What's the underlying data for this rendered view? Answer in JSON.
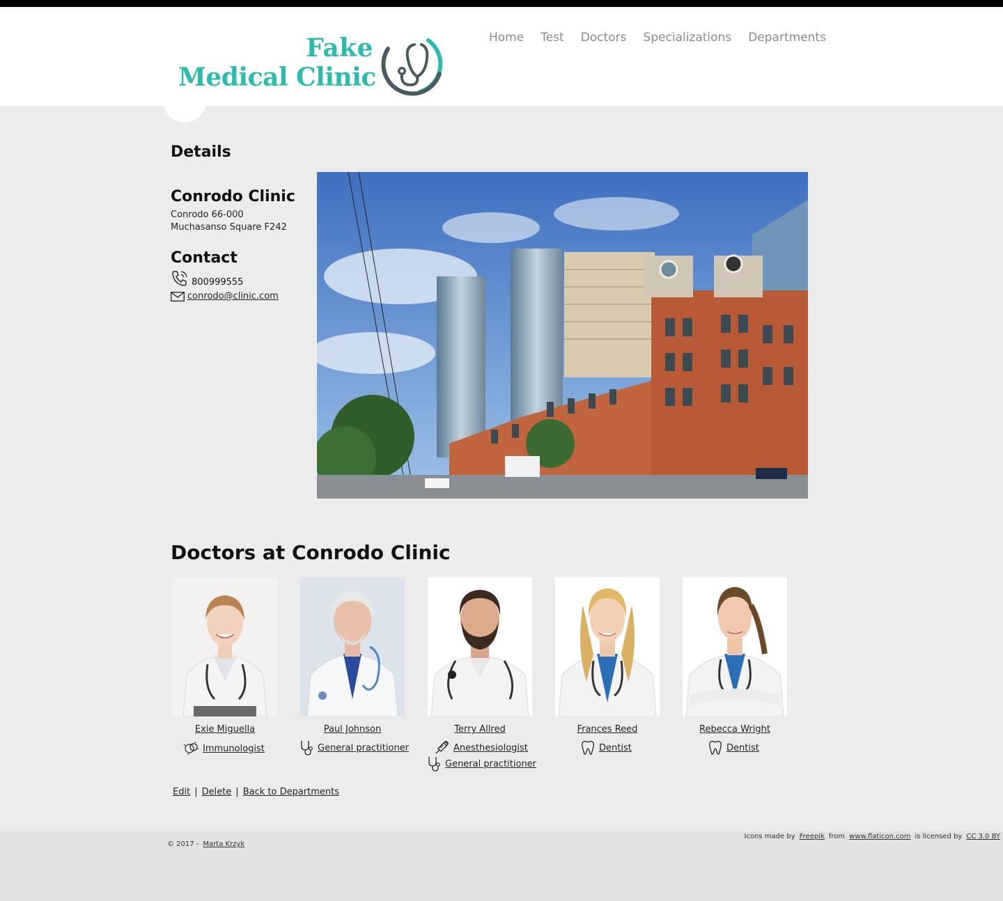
{
  "brand": {
    "line1": "Fake",
    "line2": "Medical Clinic",
    "color": "#2bbcad"
  },
  "nav": [
    {
      "label": "Home"
    },
    {
      "label": "Test"
    },
    {
      "label": "Doctors"
    },
    {
      "label": "Specializations"
    },
    {
      "label": "Departments"
    }
  ],
  "details": {
    "heading": "Details",
    "clinic_name": "Conrodo Clinic",
    "address_line1": "Conrodo 66-000",
    "address_line2": "Muchasanso Square F242",
    "contact_heading": "Contact",
    "phone": "800999555",
    "email": "conrodo@clinic.com"
  },
  "doctors_heading": "Doctors at Conrodo Clinic",
  "doctors": [
    {
      "name": "Exie Miguella",
      "specs": [
        {
          "label": "Immunologist",
          "icon": "immune-icon"
        }
      ]
    },
    {
      "name": "Paul Johnson",
      "specs": [
        {
          "label": "General practitioner",
          "icon": "stethoscope-icon"
        }
      ]
    },
    {
      "name": "Terry Allred",
      "specs": [
        {
          "label": "Anesthesiologist",
          "icon": "syringe-icon"
        },
        {
          "label": "General practitioner",
          "icon": "stethoscope-icon"
        }
      ]
    },
    {
      "name": "Frances Reed",
      "specs": [
        {
          "label": "Dentist",
          "icon": "tooth-icon"
        }
      ]
    },
    {
      "name": "Rebecca Wright",
      "specs": [
        {
          "label": "Dentist",
          "icon": "tooth-icon"
        }
      ]
    }
  ],
  "actions": {
    "edit": "Edit",
    "sep": "|",
    "delete": "Delete",
    "back": "Back to Departments"
  },
  "footer": {
    "copyright": "© 2017 -",
    "author": "Marta Krzyk",
    "credits_prefix": "Icons made by",
    "freepik": "Freepik",
    "from": "from",
    "flaticon": "www.flaticon.com",
    "licensed": "is licensed by",
    "license": "CC 3.0 BY"
  }
}
